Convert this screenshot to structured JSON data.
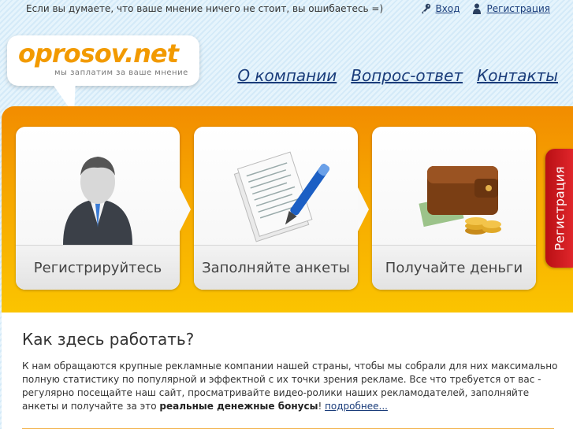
{
  "topbar": {
    "slogan": "Если вы думаете, что ваше мнение ничего не стоит, вы ошибаетесь =)",
    "login": "Вход",
    "register": "Регистрация"
  },
  "logo": {
    "name": "oprosov.net",
    "tagline": "мы заплатим за ваше мнение"
  },
  "nav": [
    "О компании",
    "Вопрос-ответ",
    "Контакты"
  ],
  "steps": [
    {
      "label": "Регистрируйтесь",
      "icon": "businessman-icon"
    },
    {
      "label": "Заполняйте анкеты",
      "icon": "documents-pen-icon"
    },
    {
      "label": "Получайте деньги",
      "icon": "wallet-coins-icon"
    }
  ],
  "side_tab": "Регистрация",
  "intro": {
    "title": "Как здесь работать?",
    "text_1": "К нам обращаются крупные рекламные компании нашей страны, чтобы мы собрали для них максимально полную статистику по популярной и эффектной с их точки зрения рекламе.  Все что требуется от вас - регулярно посещайте наш сайт, просматривайте видео-ролики наших рекламодателей, заполняйте анкеты и получайте за это ",
    "bold": "реальные денежные бонусы",
    "text_2": "! ",
    "more_link": "подробнее..."
  },
  "colors": {
    "accent_orange": "#f6a600",
    "link_blue": "#1a3c7a",
    "tab_red": "#d01d22"
  }
}
